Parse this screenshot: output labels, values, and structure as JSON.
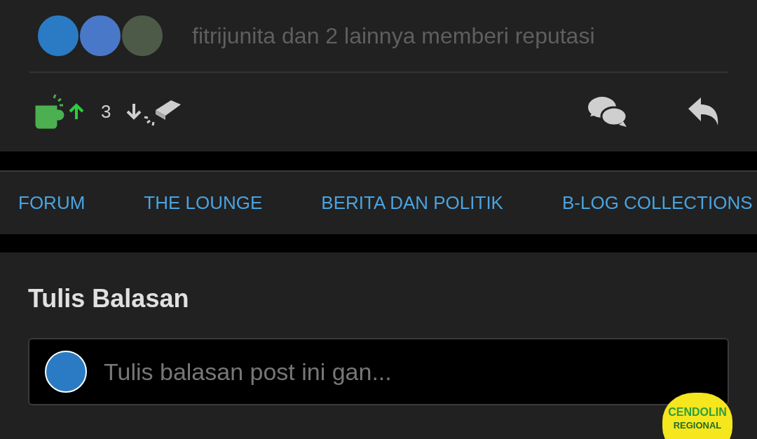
{
  "reputation": {
    "text": "fitrijunita dan 2 lainnya memberi reputasi"
  },
  "votes": {
    "count": "3"
  },
  "nav": [
    {
      "label": "FORUM"
    },
    {
      "label": "THE LOUNGE"
    },
    {
      "label": "BERITA DAN POLITIK"
    },
    {
      "label": "B-LOG COLLECTIONS"
    }
  ],
  "reply": {
    "title": "Tulis Balasan",
    "placeholder": "Tulis balasan post ini gan..."
  },
  "badge": {
    "line_1": "CENDOLIN",
    "line_2": "REGIONAL"
  }
}
